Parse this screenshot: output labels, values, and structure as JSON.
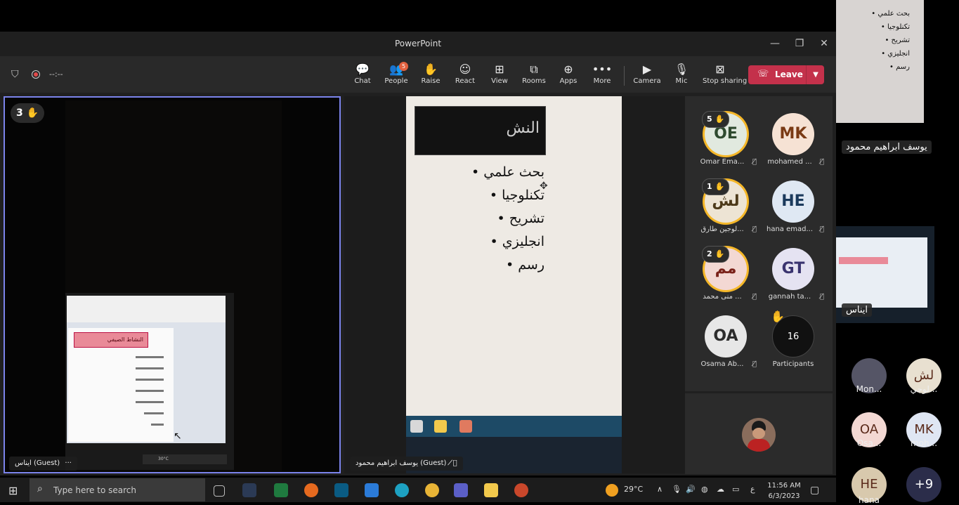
{
  "window": {
    "title": "PowerPoint",
    "controls": [
      "—",
      "❐",
      "✕"
    ]
  },
  "meeting": {
    "timer": "--:--"
  },
  "toolbar": {
    "items": [
      {
        "id": "chat",
        "label": "Chat",
        "icon": "chat-icon",
        "glyph": "💬"
      },
      {
        "id": "people",
        "label": "People",
        "icon": "people-icon",
        "glyph": "👥",
        "badge": "5"
      },
      {
        "id": "raise",
        "label": "Raise",
        "icon": "hand-icon",
        "glyph": "✋"
      },
      {
        "id": "react",
        "label": "React",
        "icon": "smile-icon",
        "glyph": "☺"
      },
      {
        "id": "view",
        "label": "View",
        "icon": "grid-icon",
        "glyph": "⊞"
      },
      {
        "id": "rooms",
        "label": "Rooms",
        "icon": "rooms-icon",
        "glyph": "⧉"
      },
      {
        "id": "apps",
        "label": "Apps",
        "icon": "plus-icon",
        "glyph": "⊕"
      },
      {
        "id": "more",
        "label": "More",
        "icon": "ellipsis-icon",
        "glyph": "•••"
      },
      {
        "id": "camera",
        "label": "Camera",
        "icon": "camera-off-icon",
        "glyph": "▶"
      },
      {
        "id": "mic",
        "label": "Mic",
        "icon": "mic-icon",
        "glyph": "🎙"
      },
      {
        "id": "stop",
        "label": "Stop sharing",
        "icon": "stop-share-icon",
        "glyph": "⊠"
      }
    ],
    "leave_label": "Leave"
  },
  "tiles": {
    "left": {
      "hand_count": "3",
      "name": "ايناس (Guest)",
      "more": "···",
      "doc_title": "النشاط الصيفي",
      "taskbar_temp": "30°C"
    },
    "mid": {
      "name": "يوسف ابراهيم محمود (Guest)",
      "slide_banner": "النش",
      "slide_items": [
        "بحث علمي",
        "تكنلوجيا",
        "تشريح",
        "انجليزي",
        "رسم"
      ]
    }
  },
  "gallery": {
    "participants": [
      {
        "initials": "OE",
        "name": "Omar Ema...",
        "hand": "5",
        "bg": "#e1e9df",
        "fg": "#2f4a2f",
        "raised": true
      },
      {
        "initials": "MK",
        "name": "mohamed ...",
        "bg": "#f6e2d4",
        "fg": "#7a3a14",
        "raised": false
      },
      {
        "initials": "لش",
        "name": "لوجين طارق...",
        "hand": "1",
        "bg": "#ede4d4",
        "fg": "#4d3a1a",
        "raised": true
      },
      {
        "initials": "HE",
        "name": "hana emad...",
        "bg": "#dfe8f3",
        "fg": "#1b3a5c",
        "raised": false
      },
      {
        "initials": "مم",
        "name": "منى محمد ...",
        "hand": "2",
        "bg": "#f3d8d3",
        "fg": "#7a221a",
        "raised": true
      },
      {
        "initials": "GT",
        "name": "gannah ta...",
        "bg": "#e5e3f2",
        "fg": "#3a3470",
        "raised": false
      },
      {
        "initials": "OA",
        "name": "Osama Ab...",
        "bg": "#e7e7e7",
        "fg": "#2c2c2c",
        "raised": false
      }
    ],
    "overflow": {
      "count": "16",
      "label": "Participants"
    }
  },
  "right_strip": {
    "slide_items": [
      "بحث علمي",
      "تكنلوجيا",
      "تشريح",
      "انجليزي",
      "رسم"
    ],
    "name_top": "يوسف ابراهيم محمود",
    "name_mid": "ايناس",
    "people": [
      {
        "initials": "",
        "name": "Mon...",
        "bg": "#556"
      },
      {
        "initials": "لش",
        "name": "لوجي...",
        "bg": "#e8e0d0"
      },
      {
        "initials": "OA",
        "name": "Osa...",
        "bg": "#f3d8d3"
      },
      {
        "initials": "MK",
        "name": "moh...",
        "bg": "#dfe6f3"
      },
      {
        "initials": "HE",
        "name": "hana",
        "bg": "#d8c9ad"
      },
      {
        "initials": "+9",
        "name": "",
        "bg": "#2b2d4a"
      }
    ]
  },
  "taskbar": {
    "search_placeholder": "Type here to search",
    "weather": "29°C",
    "lang": "ع",
    "time": "11:56 AM",
    "date": "6/3/2023"
  },
  "colors": {
    "accent": "#7b83eb",
    "leave": "#c4314b",
    "hand": "#f5b728"
  }
}
